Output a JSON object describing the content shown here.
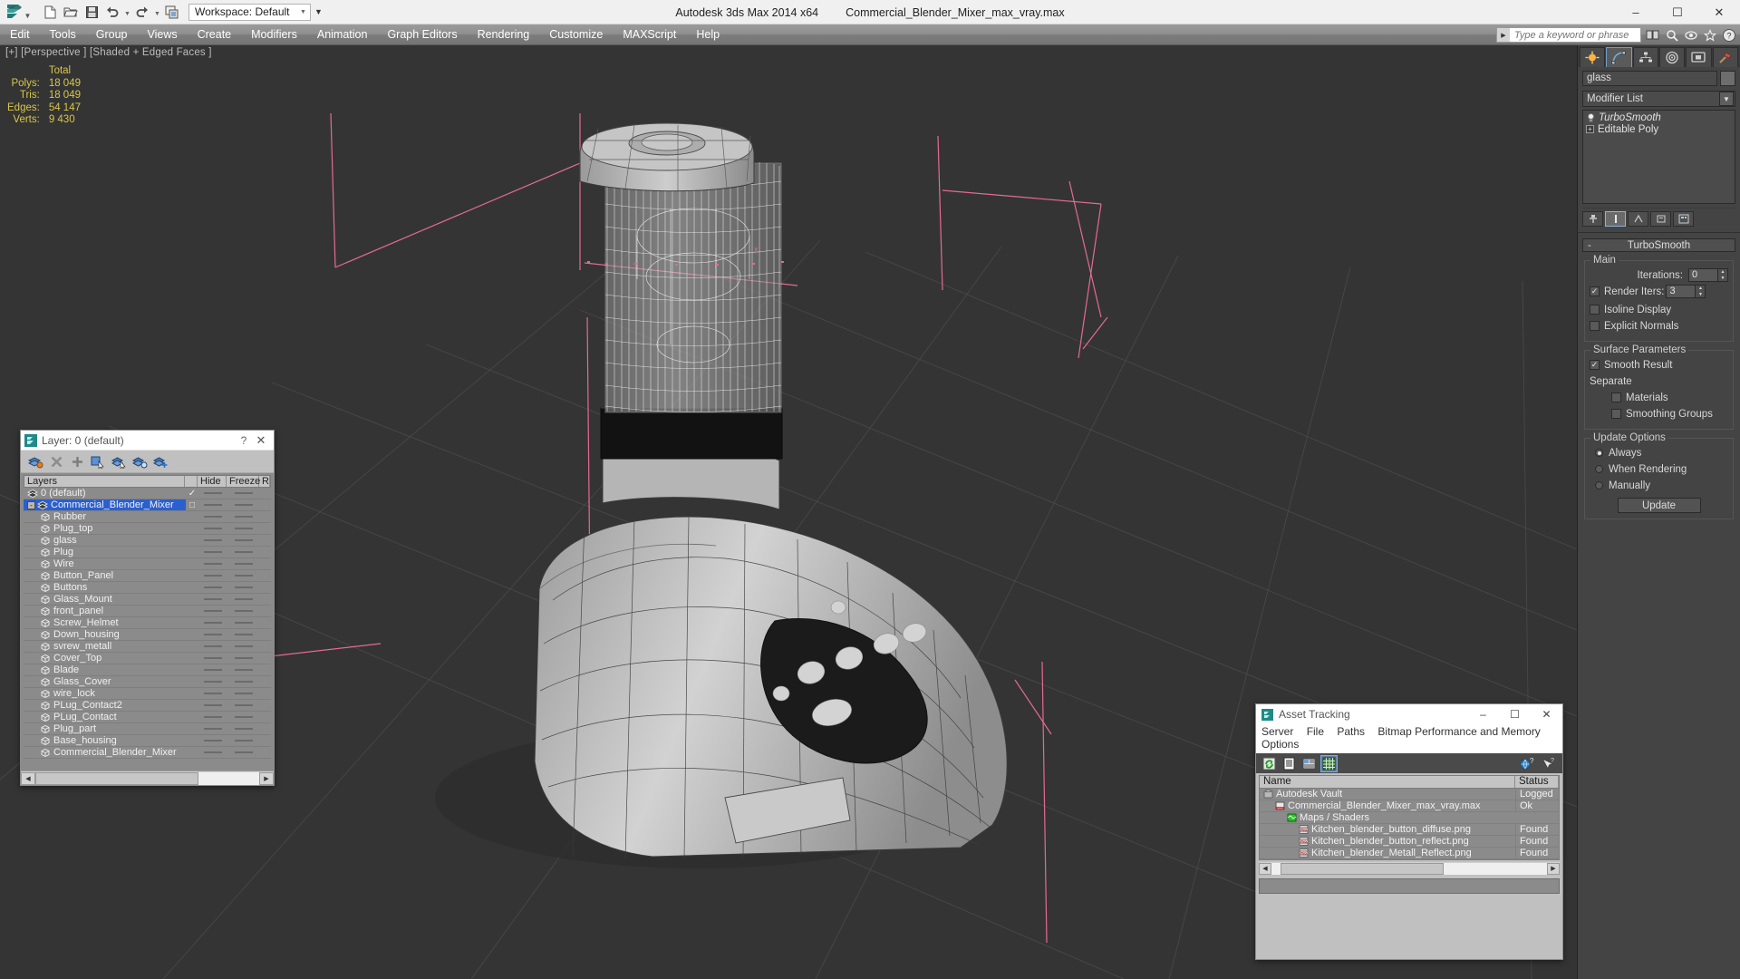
{
  "titlebar": {
    "app_title": "Autodesk 3ds Max  2014 x64",
    "file_title": "Commercial_Blender_Mixer_max_vray.max",
    "workspace_label": "Workspace: Default",
    "quick_access": [
      {
        "name": "new-file-icon",
        "label": "New"
      },
      {
        "name": "open-file-icon",
        "label": "Open"
      },
      {
        "name": "save-file-icon",
        "label": "Save"
      },
      {
        "name": "undo-icon",
        "label": "Undo"
      },
      {
        "name": "redo-icon",
        "label": "Redo"
      },
      {
        "name": "project-folder-icon",
        "label": "Set Project Folder"
      }
    ],
    "window_buttons": {
      "minimize": "–",
      "maximize": "☐",
      "close": "✕"
    }
  },
  "menubar": {
    "items": [
      "Edit",
      "Tools",
      "Group",
      "Views",
      "Create",
      "Modifiers",
      "Animation",
      "Graph Editors",
      "Rendering",
      "Customize",
      "MAXScript",
      "Help"
    ],
    "search_placeholder": "Type a keyword or phrase"
  },
  "viewport": {
    "label": "[+] [Perspective ] [Shaded + Edged Faces ]",
    "stats_header": "Total",
    "stats": [
      {
        "label": "Polys:",
        "value": "18 049"
      },
      {
        "label": "Tris:",
        "value": "18 049"
      },
      {
        "label": "Edges:",
        "value": "54 147"
      },
      {
        "label": "Verts:",
        "value": "9 430"
      }
    ],
    "stats_color": "#d8c64a",
    "background_color": "#343434"
  },
  "command_panel": {
    "tabs": [
      {
        "name": "create-tab",
        "icon": "star-icon",
        "active": false
      },
      {
        "name": "modify-tab",
        "icon": "curve-icon",
        "active": true
      },
      {
        "name": "hierarchy-tab",
        "icon": "hierarchy-icon",
        "active": false
      },
      {
        "name": "motion-tab",
        "icon": "wheel-icon",
        "active": false
      },
      {
        "name": "display-tab",
        "icon": "monitor-icon",
        "active": false
      },
      {
        "name": "utilities-tab",
        "icon": "hammer-icon",
        "active": false
      }
    ],
    "object_name": "glass",
    "object_color": "#6d6d6d",
    "modifier_list_label": "Modifier List",
    "stack": [
      {
        "label": "TurboSmooth",
        "active": true,
        "italic": true
      },
      {
        "label": "Editable Poly",
        "active": false,
        "italic": false
      }
    ],
    "rollout": {
      "title": "TurboSmooth",
      "toggle": "-",
      "main_group": "Main",
      "iterations_label": "Iterations:",
      "iterations_value": "0",
      "render_iters_label": "Render Iters:",
      "render_iters_value": "3",
      "render_iters_checked": true,
      "isoline_label": "Isoline Display",
      "isoline_checked": false,
      "explicit_label": "Explicit Normals",
      "explicit_checked": false,
      "surface_group": "Surface Parameters",
      "smooth_result_label": "Smooth Result",
      "smooth_result_checked": true,
      "separate_label": "Separate",
      "materials_label": "Materials",
      "materials_checked": false,
      "smoothing_groups_label": "Smoothing Groups",
      "smoothing_groups_checked": false,
      "update_group": "Update Options",
      "update_options": [
        "Always",
        "When Rendering",
        "Manually"
      ],
      "update_selected": "Always",
      "update_button": "Update"
    }
  },
  "layer_dialog": {
    "title": "Layer: 0 (default)",
    "help_glyph": "?",
    "close_glyph": "✕",
    "toolbar": [
      {
        "name": "new-layer-icon"
      },
      {
        "name": "delete-layer-icon"
      },
      {
        "name": "add-layer-icon"
      },
      {
        "name": "select-objects-in-layer-icon"
      },
      {
        "name": "select-highlighted-layer-icon"
      },
      {
        "name": "highlight-selected-objects-layer-icon"
      },
      {
        "name": "add-selection-to-layer-icon"
      }
    ],
    "columns": [
      "Layers",
      "",
      "Hide",
      "Freeze",
      "R"
    ],
    "rows": [
      {
        "label": "0 (default)",
        "type": "layer",
        "indent": 0,
        "check": "✓",
        "selected": false,
        "expander": null
      },
      {
        "label": "Commercial_Blender_Mixer",
        "type": "layer",
        "indent": 0,
        "check": "□",
        "selected": true,
        "expander": "-"
      },
      {
        "label": "Rubber",
        "type": "object",
        "indent": 1,
        "check": "",
        "selected": false,
        "expander": null
      },
      {
        "label": "Plug_top",
        "type": "object",
        "indent": 1,
        "check": "",
        "selected": false,
        "expander": null
      },
      {
        "label": "glass",
        "type": "object",
        "indent": 1,
        "check": "",
        "selected": false,
        "expander": null
      },
      {
        "label": "Plug",
        "type": "object",
        "indent": 1,
        "check": "",
        "selected": false,
        "expander": null
      },
      {
        "label": "Wire",
        "type": "object",
        "indent": 1,
        "check": "",
        "selected": false,
        "expander": null
      },
      {
        "label": "Button_Panel",
        "type": "object",
        "indent": 1,
        "check": "",
        "selected": false,
        "expander": null
      },
      {
        "label": "Buttons",
        "type": "object",
        "indent": 1,
        "check": "",
        "selected": false,
        "expander": null
      },
      {
        "label": "Glass_Mount",
        "type": "object",
        "indent": 1,
        "check": "",
        "selected": false,
        "expander": null
      },
      {
        "label": "front_panel",
        "type": "object",
        "indent": 1,
        "check": "",
        "selected": false,
        "expander": null
      },
      {
        "label": "Screw_Helmet",
        "type": "object",
        "indent": 1,
        "check": "",
        "selected": false,
        "expander": null
      },
      {
        "label": "Down_housing",
        "type": "object",
        "indent": 1,
        "check": "",
        "selected": false,
        "expander": null
      },
      {
        "label": "svrew_metall",
        "type": "object",
        "indent": 1,
        "check": "",
        "selected": false,
        "expander": null
      },
      {
        "label": "Cover_Top",
        "type": "object",
        "indent": 1,
        "check": "",
        "selected": false,
        "expander": null
      },
      {
        "label": "Blade",
        "type": "object",
        "indent": 1,
        "check": "",
        "selected": false,
        "expander": null
      },
      {
        "label": "Glass_Cover",
        "type": "object",
        "indent": 1,
        "check": "",
        "selected": false,
        "expander": null
      },
      {
        "label": "wire_lock",
        "type": "object",
        "indent": 1,
        "check": "",
        "selected": false,
        "expander": null
      },
      {
        "label": "PLug_Contact2",
        "type": "object",
        "indent": 1,
        "check": "",
        "selected": false,
        "expander": null
      },
      {
        "label": "PLug_Contact",
        "type": "object",
        "indent": 1,
        "check": "",
        "selected": false,
        "expander": null
      },
      {
        "label": "Plug_part",
        "type": "object",
        "indent": 1,
        "check": "",
        "selected": false,
        "expander": null
      },
      {
        "label": "Base_housing",
        "type": "object",
        "indent": 1,
        "check": "",
        "selected": false,
        "expander": null
      },
      {
        "label": "Commercial_Blender_Mixer",
        "type": "object",
        "indent": 1,
        "check": "",
        "selected": false,
        "expander": null
      }
    ],
    "selection_color": "#2a5fd0"
  },
  "asset_tracking": {
    "title": "Asset Tracking",
    "window_buttons": {
      "minimize": "–",
      "maximize": "☐",
      "close": "✕"
    },
    "menu": [
      "Server",
      "File",
      "Paths",
      "Bitmap Performance and Memory",
      "Options"
    ],
    "toolbar": [
      {
        "name": "refresh-icon",
        "selected": false
      },
      {
        "name": "list-view-icon",
        "selected": false
      },
      {
        "name": "details-view-icon",
        "selected": false
      },
      {
        "name": "grid-view-icon",
        "selected": true
      }
    ],
    "toolbar_right": [
      {
        "name": "help-globe-icon"
      },
      {
        "name": "help-pointer-icon"
      }
    ],
    "columns": [
      "Name",
      "Status"
    ],
    "rows": [
      {
        "name": "Autodesk Vault",
        "status": "Logged",
        "indent": 0,
        "icon": "vault-icon"
      },
      {
        "name": "Commercial_Blender_Mixer_max_vray.max",
        "status": "Ok",
        "indent": 1,
        "icon": "max-file-icon"
      },
      {
        "name": "Maps / Shaders",
        "status": "",
        "indent": 2,
        "icon": "maps-icon"
      },
      {
        "name": "Kitchen_blender_button_diffuse.png",
        "status": "Found",
        "indent": 3,
        "icon": "png-icon"
      },
      {
        "name": "Kitchen_blender_button_reflect.png",
        "status": "Found",
        "indent": 3,
        "icon": "png-icon"
      },
      {
        "name": "Kitchen_blender_Metall_Reflect.png",
        "status": "Found",
        "indent": 3,
        "icon": "png-icon"
      }
    ]
  }
}
